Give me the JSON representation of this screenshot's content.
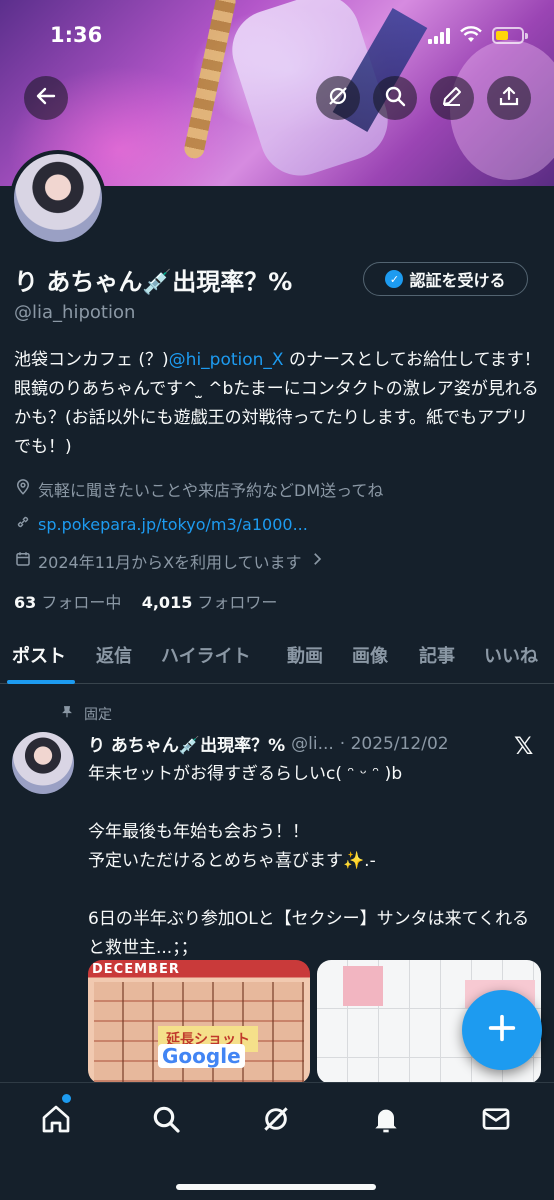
{
  "status_bar": {
    "time": "1:36"
  },
  "profile": {
    "display_name": "り あちゃん💉出現率？%",
    "handle": "@lia_hipotion",
    "verify_button": "認証を受ける",
    "bio_before": "池袋コンカフェ (？)",
    "bio_mention": "@hi_potion_X",
    "bio_after": " のナースとしてお給仕してます！眼鏡のりあちゃんです^ ̫ ^bたまーにコンタクトの激レア姿が見れるかも？(お話以外にも遊戯王の対戦待ってたりします。紙でもアプリでも！)",
    "location": "気軽に聞きたいことや来店予約などDM送ってね",
    "website": "sp.pokepara.jp/tokyo/m3/a1000...",
    "joined": "2024年11月からXを利用しています",
    "following_count": "63",
    "following_label": "フォロー中",
    "followers_count": "4,015",
    "followers_label": "フォロワー"
  },
  "tabs": [
    "ポスト",
    "返信",
    "ハイライト",
    "動画",
    "画像",
    "記事",
    "いいね"
  ],
  "pinned_post": {
    "pinned_label": "固定",
    "author_name": "り あちゃん💉出現率？%",
    "author_handle": "@li...",
    "date": "· 2025/12/02",
    "text": "年末セットがお得すぎるらしいc( ᵔ ᵕ ᵔ )b\n\n今年最後も年始も会おう！！\n予定いただけるとめちゃ喜びます✨.-\n\n6日の半年ぶり参加OLと【セクシー】サンタは来てくれると救世主...；；",
    "media1_label": "DECEMBER",
    "media1_ticket": "延長ショット",
    "media1_google": "Google"
  },
  "icons": {
    "back": "back-arrow-icon",
    "grok": "grok-icon",
    "search": "search-icon",
    "edit": "edit-icon",
    "share": "share-icon",
    "location": "location-pin-icon",
    "link": "link-icon",
    "calendar": "calendar-icon",
    "pin": "pin-icon",
    "compose": "plus-icon",
    "home": "home-icon",
    "notifications": "bell-icon",
    "messages": "envelope-icon"
  },
  "colors": {
    "accent": "#1d9bf0",
    "background": "#15202b",
    "muted": "#8b98a5"
  }
}
